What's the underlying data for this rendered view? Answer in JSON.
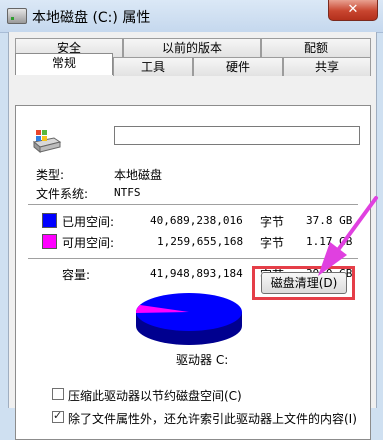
{
  "window": {
    "title": "本地磁盘 (C:) 属性",
    "close_symbol": "✕"
  },
  "tabs_row_back": [
    "安全",
    "以前的版本",
    "配额"
  ],
  "tabs_row_front": [
    "常规",
    "工具",
    "硬件",
    "共享"
  ],
  "active_tab": "常规",
  "drive": {
    "icon": "drive-icon",
    "name_value": ""
  },
  "info": {
    "type_label": "类型:",
    "type_value": "本地磁盘",
    "fs_label": "文件系统:",
    "fs_value": "NTFS"
  },
  "space": {
    "used": {
      "label": "已用空间:",
      "bytes": "40,689,238,016",
      "unit": "字节",
      "size": "37.8 GB",
      "color": "#0000ff"
    },
    "free": {
      "label": "可用空间:",
      "bytes": "1,259,655,168",
      "unit": "字节",
      "size": "1.17 GB",
      "color": "#ff00ff"
    },
    "capacity": {
      "label": "容量:",
      "bytes": "41,948,893,184",
      "unit": "字节",
      "size": "39.0 GB"
    }
  },
  "drive_label": "驱动器 C:",
  "cleanup_button": "磁盘清理(D)",
  "checkboxes": [
    {
      "label": "压缩此驱动器以节约磁盘空间(C)",
      "checked": false
    },
    {
      "label": "除了文件属性外，还允许索引此驱动器上文件的内容(I)",
      "checked": true
    }
  ],
  "annotation_color": "#e040e0",
  "highlight_color": "#e53e48"
}
